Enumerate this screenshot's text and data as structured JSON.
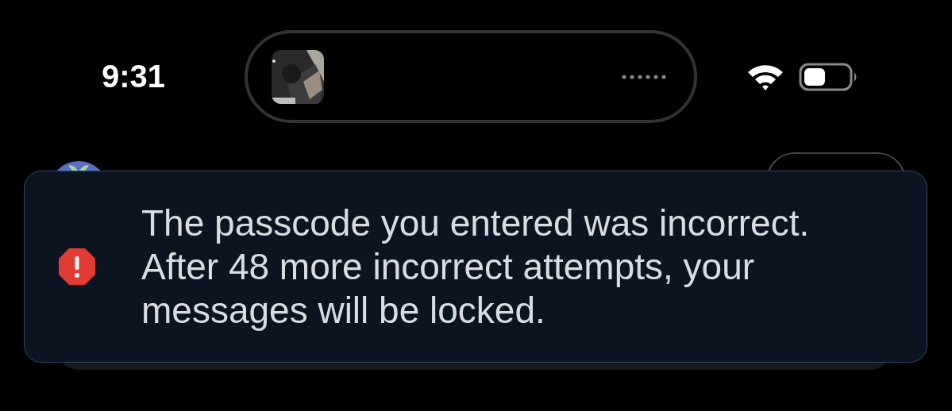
{
  "status_bar": {
    "time": "9:31"
  },
  "alert": {
    "kind": "error",
    "message": "The passcode you entered was incorrect. After 48 more incorrect attempts, your messages will be locked."
  }
}
